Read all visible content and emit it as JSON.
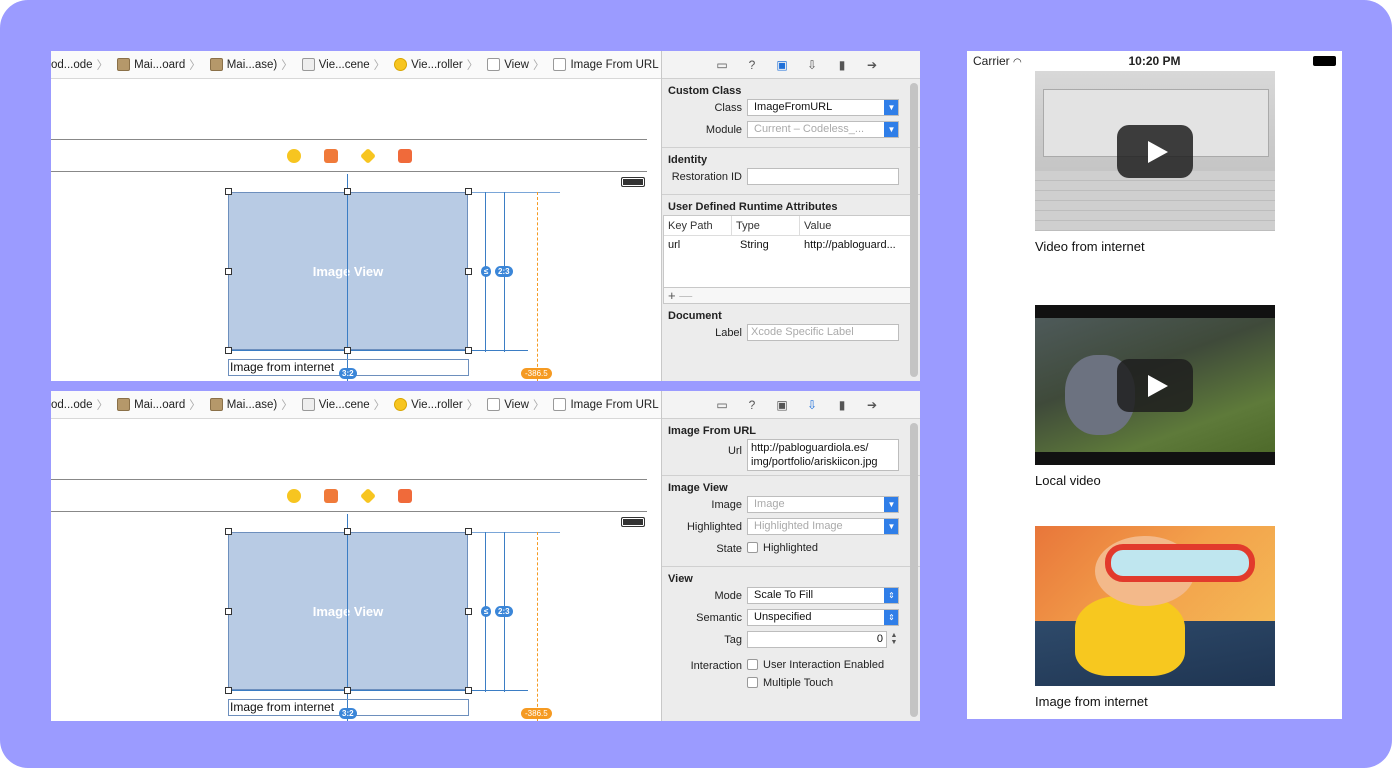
{
  "xcode": {
    "breadcrumbs": [
      "od...ode",
      "Mai...oard",
      "Mai...ase)",
      "Vie...cene",
      "Vie...roller",
      "View",
      "Image From URL"
    ],
    "image_view_label": "Image View",
    "label_text": "Image from internet",
    "constraint_ratio": "2:3",
    "constraint_32": "3:2",
    "constraint_offset": "-386.5",
    "inspector_identity": {
      "custom_class_title": "Custom Class",
      "class_label": "Class",
      "class_value": "ImageFromURL",
      "module_label": "Module",
      "module_placeholder": "Current – Codeless_...",
      "identity_title": "Identity",
      "restoration_label": "Restoration ID",
      "uda_title": "User Defined Runtime Attributes",
      "col_keypath": "Key Path",
      "col_type": "Type",
      "col_value": "Value",
      "row_keypath": "url",
      "row_type": "String",
      "row_value": "http://pabloguard...",
      "document_title": "Document",
      "doc_label_label": "Label",
      "doc_label_placeholder": "Xcode Specific Label"
    },
    "inspector_attributes": {
      "ifu_title": "Image From URL",
      "url_label": "Url",
      "url_value_1": "http://pabloguardiola.es/",
      "url_value_2": "img/portfolio/ariskiicon.jpg",
      "imageview_title": "Image View",
      "image_label": "Image",
      "image_placeholder": "Image",
      "highlighted_label": "Highlighted",
      "highlighted_placeholder": "Highlighted Image",
      "state_label": "State",
      "state_check": "Highlighted",
      "view_title": "View",
      "mode_label": "Mode",
      "mode_value": "Scale To Fill",
      "semantic_label": "Semantic",
      "semantic_value": "Unspecified",
      "tag_label": "Tag",
      "tag_value": "0",
      "interaction_label": "Interaction",
      "interaction_check1": "User Interaction Enabled",
      "interaction_check2": "Multiple Touch"
    }
  },
  "ios": {
    "carrier": "Carrier",
    "time": "10:20 PM",
    "captions": [
      "Video from internet",
      "Local video",
      "Image from internet"
    ]
  },
  "colors": {
    "background": "#9b9bff",
    "accent": "#2f7ee8",
    "constraint_orange": "#f59a22"
  }
}
